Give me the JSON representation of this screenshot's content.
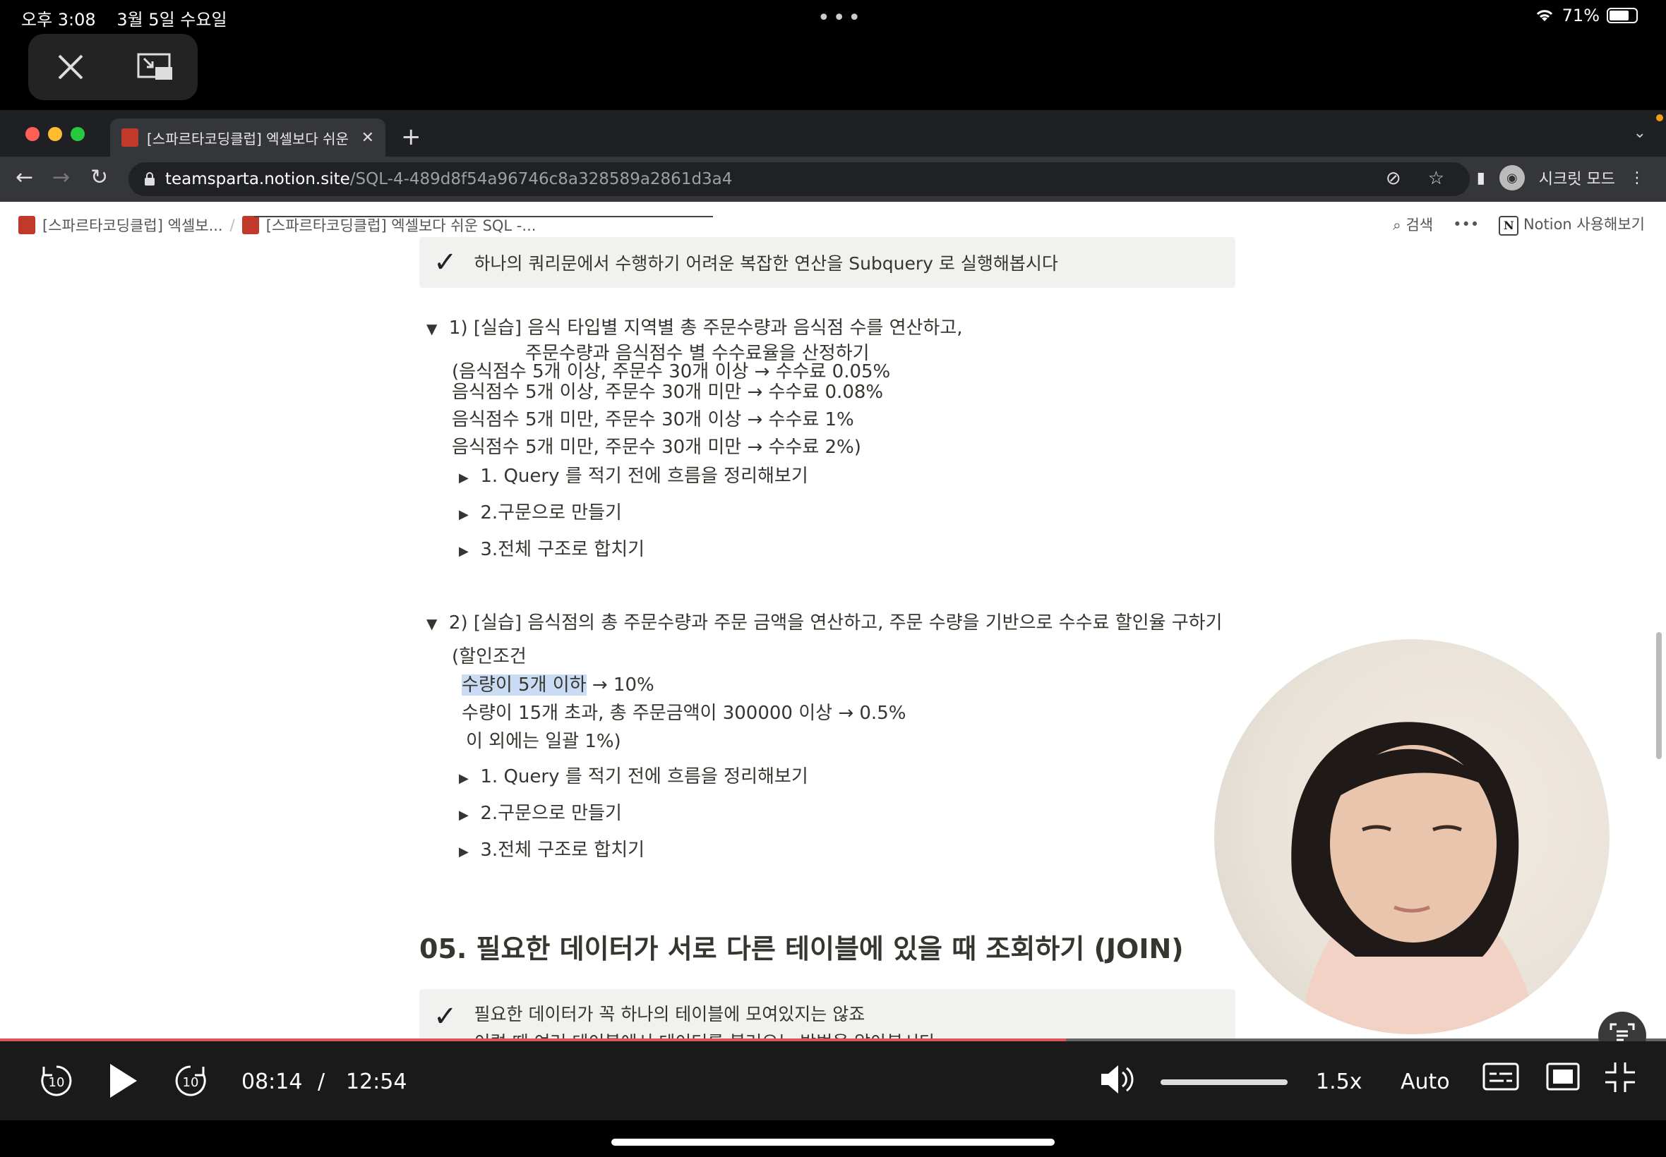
{
  "status_bar": {
    "time": "오후 3:08",
    "date": "3월 5일 수요일",
    "battery": "71%",
    "battery_level": 0.71
  },
  "browser": {
    "tab_title": "[스파르타코딩클럽] 엑셀보다 쉬운 SQL",
    "url_host": "teamsparta.notion.site",
    "url_path": "/SQL-4-489d8f54a96746c8a328589a2861d3a4",
    "profile_label": "시크릿 모드"
  },
  "notion": {
    "breadcrumb_1": "[스파르타코딩클럽] 엑셀보...",
    "breadcrumb_2": "[스파르타코딩클럽] 엑셀보다 쉬운 SQL -...",
    "search_label": "검색",
    "more_label": "•••",
    "try_label": "Notion 사용해보기"
  },
  "content": {
    "callout_top": "하나의 쿼리문에서 수행하기 어려운 복잡한 연산을 Subquery 로 실행해봅시다",
    "toggle1_title_a": "1) [실습] 음식 타입별 지역별 총 주문수량과 음식점 수를 연산하고,",
    "toggle1_title_b": "주문수량과 음식점수 별 수수료율을 산정하기",
    "cond1": [
      "(음식점수 5개 이상, 주문수 30개 이상 → 수수료 0.05%",
      " 음식점수 5개 이상, 주문수 30개 미만 → 수수료 0.08%",
      " 음식점수 5개 미만, 주문수 30개 이상 → 수수료 1%",
      " 음식점수 5개 미만, 주문수 30개 미만 → 수수료 2%)"
    ],
    "sub_toggles": [
      "1. Query 를 적기 전에 흐름을 정리해보기",
      "2.구문으로 만들기",
      "3.전체 구조로 합치기"
    ],
    "toggle2_title": "2) [실습] 음식점의 총 주문수량과 주문 금액을 연산하고, 주문 수량을 기반으로 수수료 할인율 구하기",
    "cond2_head": "(할인조건",
    "cond2_hl": "수량이 5개 이하",
    "cond2_rest": " → 10%",
    "cond2_line2": "수량이 15개 초과, 총 주문금액이 300000 이상 → 0.5%",
    "cond2_line3": "이 외에는 일괄 1%)",
    "section_heading": "05. 필요한 데이터가 서로 다른 테이블에 있을 때 조회하기 (JOIN)",
    "callout_bottom_1": "필요한 데이터가 꼭 하나의 테이블에 모여있지는 않죠",
    "callout_bottom_2": "이럴 때 여러 테이블에서 데이터를 불러오는 방법을 알아봅시다"
  },
  "player": {
    "current_time": "08:14",
    "separator": "/",
    "duration": "12:54",
    "progress": 0.64,
    "speed": "1.5x",
    "quality": "Auto",
    "skip_back": "10",
    "skip_fwd": "10"
  },
  "colors": {
    "accent_progress": "#e0535b",
    "highlight": "#c9dcf3",
    "callout_bg": "#f1f1ef"
  }
}
